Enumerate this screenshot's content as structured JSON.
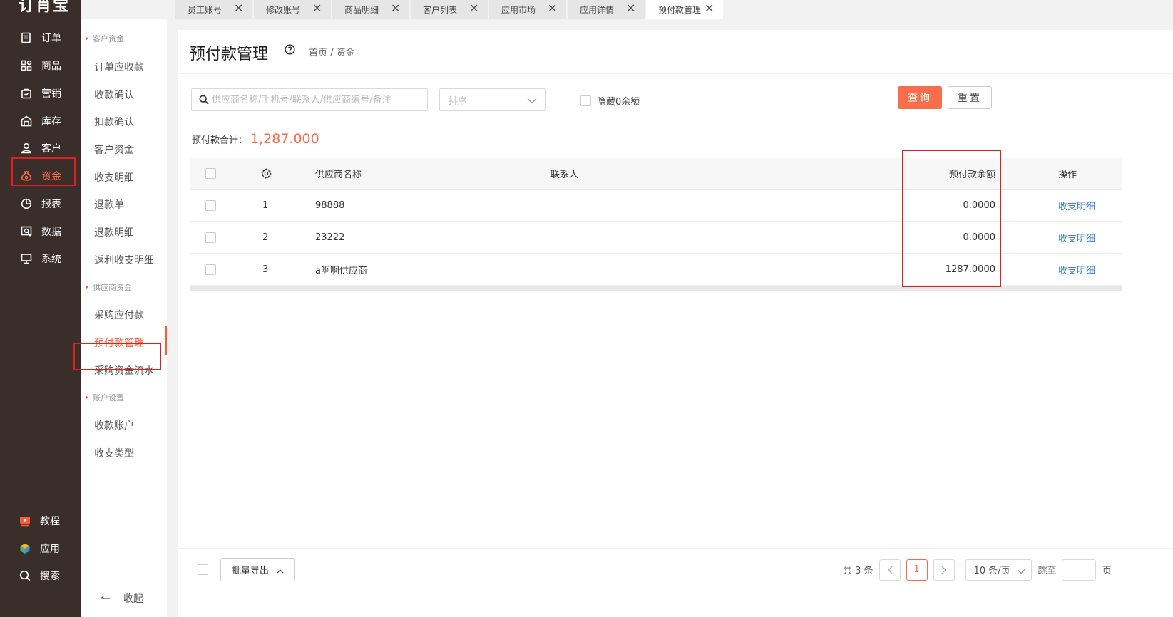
{
  "app": {
    "logo": "订肖宝"
  },
  "nav": {
    "items": [
      {
        "label": "订单",
        "icon": "order-icon"
      },
      {
        "label": "商品",
        "icon": "product-grid-icon"
      },
      {
        "label": "营销",
        "icon": "marketing-bag-icon"
      },
      {
        "label": "库存",
        "icon": "warehouse-icon"
      },
      {
        "label": "客户",
        "icon": "user-icon"
      },
      {
        "label": "资金",
        "icon": "money-bag-icon",
        "active": true
      },
      {
        "label": "报表",
        "icon": "pie-chart-icon"
      },
      {
        "label": "数据",
        "icon": "data-search-icon"
      },
      {
        "label": "系统",
        "icon": "monitor-icon"
      }
    ],
    "bottom": [
      {
        "label": "教程",
        "icon": "video-play-icon"
      },
      {
        "label": "应用",
        "icon": "cube-icon"
      },
      {
        "label": "搜索",
        "icon": "search-icon"
      }
    ]
  },
  "submenu": {
    "group1": "客户资金",
    "group1_items": [
      "订单应收款",
      "收款确认",
      "扣款确认",
      "客户资金",
      "收支明细",
      "退款单",
      "退款明细",
      "返利收支明细"
    ],
    "group2": "供应商资金",
    "group2_items": [
      "采购应付款",
      "预付款管理",
      "采购资金流水"
    ],
    "group3": "账户设置",
    "group3_items": [
      "收款账户",
      "收支类型"
    ],
    "active_item": "预付款管理",
    "collapse": "收起"
  },
  "tabs": [
    "员工账号",
    "修改账号",
    "商品明细",
    "客户列表",
    "应用市场",
    "应用详情",
    "预付款管理"
  ],
  "page": {
    "title": "预付款管理",
    "breadcrumb": "首页  /  资金"
  },
  "filters": {
    "search_placeholder": "供应商名称/手机号/联系人/供应商编号/备注",
    "sort_placeholder": "排序",
    "hide_zero_label": "隐藏0余额",
    "hide_zero_checked": false,
    "query_label": "查询",
    "reset_label": "重置"
  },
  "summary": {
    "label": "预付款合计：",
    "value": "1,287.000"
  },
  "table": {
    "columns": {
      "name": "供应商名称",
      "contact": "联系人",
      "balance": "预付款余额",
      "op": "操作"
    },
    "rows": [
      {
        "index": "1",
        "name": "98888",
        "contact": "",
        "balance": "0.0000",
        "op": "收支明细"
      },
      {
        "index": "2",
        "name": "23222",
        "contact": "",
        "balance": "0.0000",
        "op": "收支明细"
      },
      {
        "index": "3",
        "name": "a啊啊供应商",
        "contact": "",
        "balance": "1287.0000",
        "op": "收支明细"
      }
    ]
  },
  "footer": {
    "batch_export": "批量导出",
    "total_text": "共 3 条",
    "current_page": "1",
    "page_size": "10 条/页",
    "jump_label": "跳至",
    "page_unit": "页"
  },
  "colors": {
    "accent": "#fa6d4c",
    "nav_bg": "#3a2e2b",
    "link": "#3a7bd5",
    "highlight": "#e02020"
  }
}
